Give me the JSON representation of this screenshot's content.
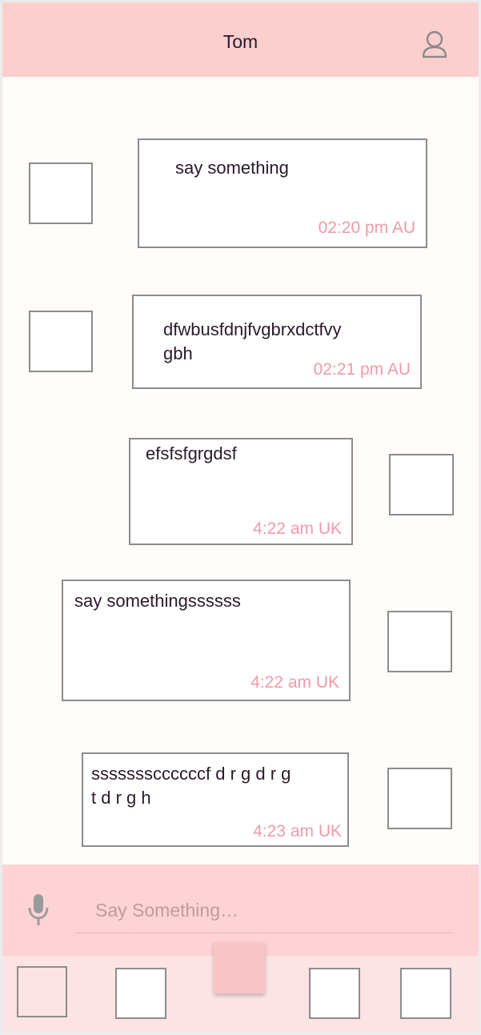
{
  "header": {
    "title": "Tom",
    "profile_icon": "user-profile-icon"
  },
  "messages": [
    {
      "text": "say something",
      "time": "02:20 pm AU",
      "side": "left"
    },
    {
      "text": "dfwbusfdnjfvgbrxdctfvy gbh",
      "time": "02:21 pm AU",
      "side": "left"
    },
    {
      "text": "efsfsfgrgdsf",
      "time": "4:22 am UK",
      "side": "right"
    },
    {
      "text": "say somethingssssss",
      "time": "4:22 am UK",
      "side": "right"
    },
    {
      "text": "sssssssccccccf d r g d r g t d r g h",
      "time": "4:23 am UK",
      "side": "right"
    }
  ],
  "composer": {
    "mic_icon": "microphone-icon",
    "placeholder": "Say Something…",
    "value": ""
  },
  "tabbar": {
    "tab_count": 5,
    "active_index": 2
  },
  "colors": {
    "header_bg": "#fccfcf",
    "chat_bg": "#fffcf9",
    "timestamp": "#f19aa6",
    "composer_bg": "#fdd3d5",
    "tabbar_bg": "#fde4e4",
    "active_tab": "#f8c6c6"
  }
}
